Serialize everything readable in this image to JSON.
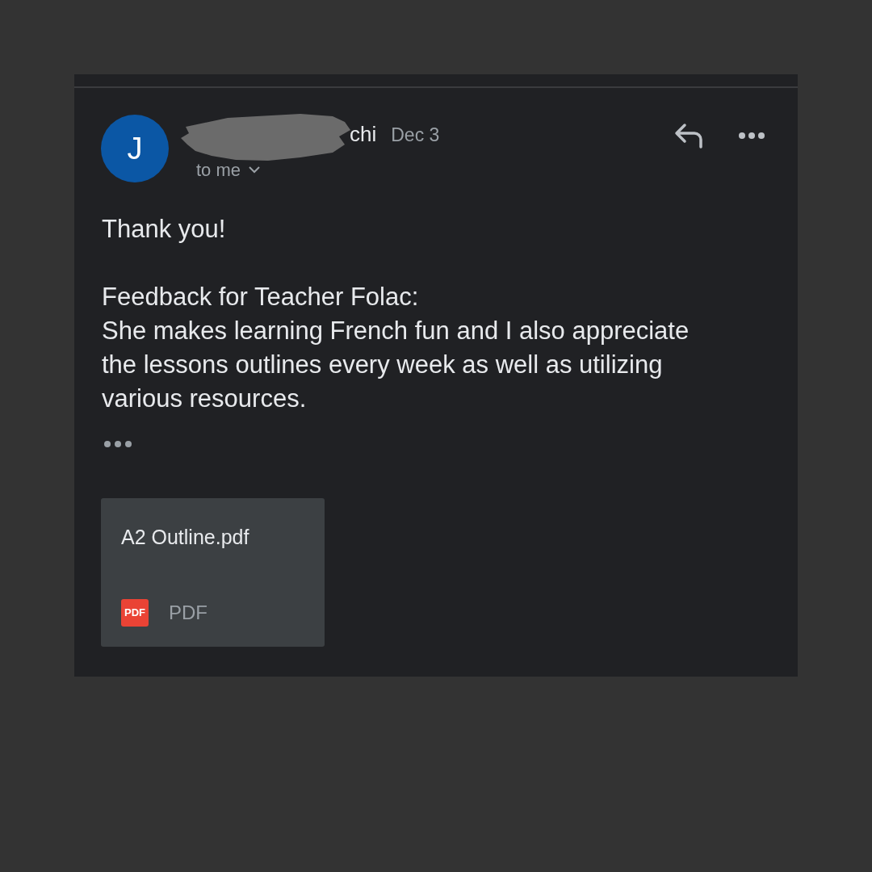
{
  "message": {
    "avatar_letter": "J",
    "sender": "chi",
    "date": "Dec 3",
    "recipient": "to me",
    "redacted": true
  },
  "body": {
    "greeting": "Thank you!",
    "heading": "Feedback for Teacher Folac:",
    "text": "She makes learning French fun and I also appreciate the lessons outlines every week as well as utilizing various resources."
  },
  "attachment": {
    "file_name": "A2 Outline.pdf",
    "icon_text": "PDF",
    "type_label": "PDF"
  }
}
